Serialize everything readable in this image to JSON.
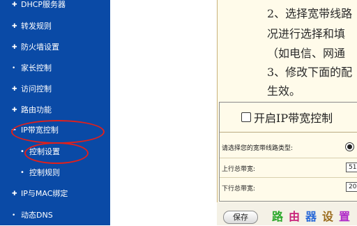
{
  "sidebar": {
    "items": [
      {
        "icon": "✚",
        "label": "DHCP服务器"
      },
      {
        "icon": "✚",
        "label": "转发规则"
      },
      {
        "icon": "✚",
        "label": "防火墙设置"
      },
      {
        "icon": "•",
        "label": "家长控制"
      },
      {
        "icon": "✚",
        "label": "访问控制"
      },
      {
        "icon": "✚",
        "label": "路由功能"
      },
      {
        "icon": "━",
        "label": "IP带宽控制"
      },
      {
        "icon": "•",
        "label": "控制设置"
      },
      {
        "icon": "•",
        "label": "控制规则"
      },
      {
        "icon": "✚",
        "label": "IP与MAC绑定"
      },
      {
        "icon": "•",
        "label": "动态DNS"
      }
    ],
    "colors": {
      "background": "#0a4aa6",
      "text": "#ffffff",
      "highlight_ring": "#e0201c"
    }
  },
  "instructions": {
    "line1": "2、选择宽带线路",
    "line2": "况进行选择和填",
    "line3": "（如电信、网通",
    "line4": "3、修改下面的配",
    "line5": "生效。"
  },
  "control": {
    "enable_label": "开启IP带宽控制",
    "line_type_label": "请选择您的宽带线路类型:",
    "upload_label": "上行总带宽:",
    "upload_value": "51",
    "download_label": "下行总带宽:",
    "download_value": "20"
  },
  "footer": {
    "save_label": "保存",
    "watermark": [
      "路",
      "由",
      "器",
      "设",
      "置"
    ],
    "watermark_colors": [
      "#2aa82a",
      "#c8227a",
      "#2a6ad8",
      "#9a6a1a",
      "#b02ac8"
    ]
  },
  "theme": {
    "panel_bg": "#fffbea"
  }
}
